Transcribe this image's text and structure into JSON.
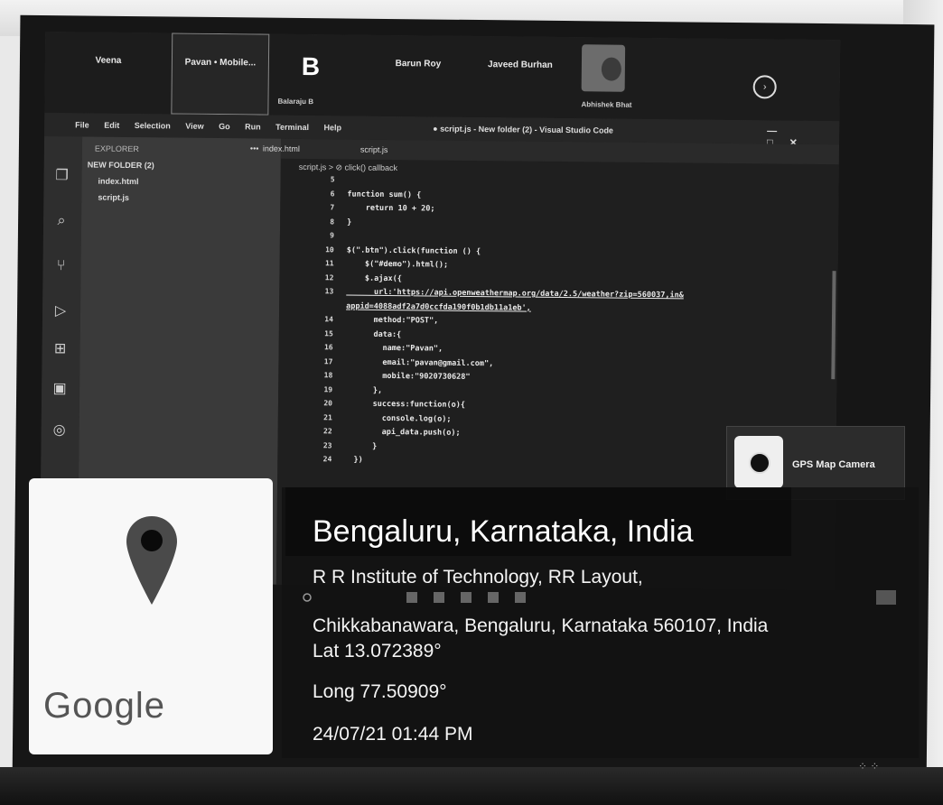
{
  "scene": {
    "description_label": "photo"
  },
  "meeting": {
    "participants": [
      {
        "name": "Veena",
        "sub": ""
      },
      {
        "name": "Pavan • Mobile...",
        "sub": ""
      },
      {
        "name": "B",
        "sub": "Balaraju B"
      },
      {
        "name": "Barun Roy",
        "sub": ""
      },
      {
        "name": "Javeed Burhan",
        "sub": ""
      },
      {
        "name": "",
        "sub": "Abhishek Bhat"
      }
    ]
  },
  "vscode": {
    "menu": [
      "File",
      "Edit",
      "Selection",
      "View",
      "Go",
      "Run",
      "Terminal",
      "Help"
    ],
    "window_title": "● script.js - New folder (2) - Visual Studio Code",
    "explorer_header": "EXPLORER",
    "folder": "NEW FOLDER (2)",
    "files": [
      "index.html",
      "script.js"
    ],
    "tabs": [
      "index.html",
      "script.js"
    ],
    "breadcrumb": "script.js > ⊘ click() callback",
    "lines": [
      {
        "n": "5",
        "code": ""
      },
      {
        "n": "6",
        "code": "function sum() {"
      },
      {
        "n": "7",
        "code": "    return 10 + 20;"
      },
      {
        "n": "8",
        "code": "}"
      },
      {
        "n": "9",
        "code": ""
      },
      {
        "n": "10",
        "code": "$(\".btn\").click(function () {"
      },
      {
        "n": "11",
        "code": "    $(\"#demo\").html();"
      },
      {
        "n": "12",
        "code": "    $.ajax({"
      },
      {
        "n": "13",
        "code": "      url:'https://api.openweathermap.org/data/2.5/weather?zip=560037,in&"
      },
      {
        "n": "",
        "code": "appid=4088adf2a7d0ccfda190f0b1db11a1eb',"
      },
      {
        "n": "14",
        "code": "      method:\"POST\","
      },
      {
        "n": "15",
        "code": "      data:{"
      },
      {
        "n": "16",
        "code": "        name:\"Pavan\","
      },
      {
        "n": "17",
        "code": "        email:\"pavan@gmail.com\","
      },
      {
        "n": "18",
        "code": "        mobile:\"9020730628\""
      },
      {
        "n": "19",
        "code": "      },"
      },
      {
        "n": "20",
        "code": "      success:function(o){"
      },
      {
        "n": "21",
        "code": "        console.log(o);"
      },
      {
        "n": "22",
        "code": "        api_data.push(o);"
      },
      {
        "n": "23",
        "code": "      }"
      },
      {
        "n": "24",
        "code": "  })"
      }
    ]
  },
  "gps": {
    "app_name": "GPS Map Camera",
    "map_brand": "Google",
    "title": "Bengaluru, Karnataka, India",
    "address_line1": "R R Institute of Technology, RR Layout,",
    "address_line2": "Chikkabanawara, Bengaluru, Karnataka 560107, India",
    "lat": "Lat 13.072389°",
    "long": "Long 77.50909°",
    "datetime": "24/07/21 01:44 PM"
  },
  "icons": {
    "pin": "map-pin-icon",
    "camera": "camera-icon"
  }
}
